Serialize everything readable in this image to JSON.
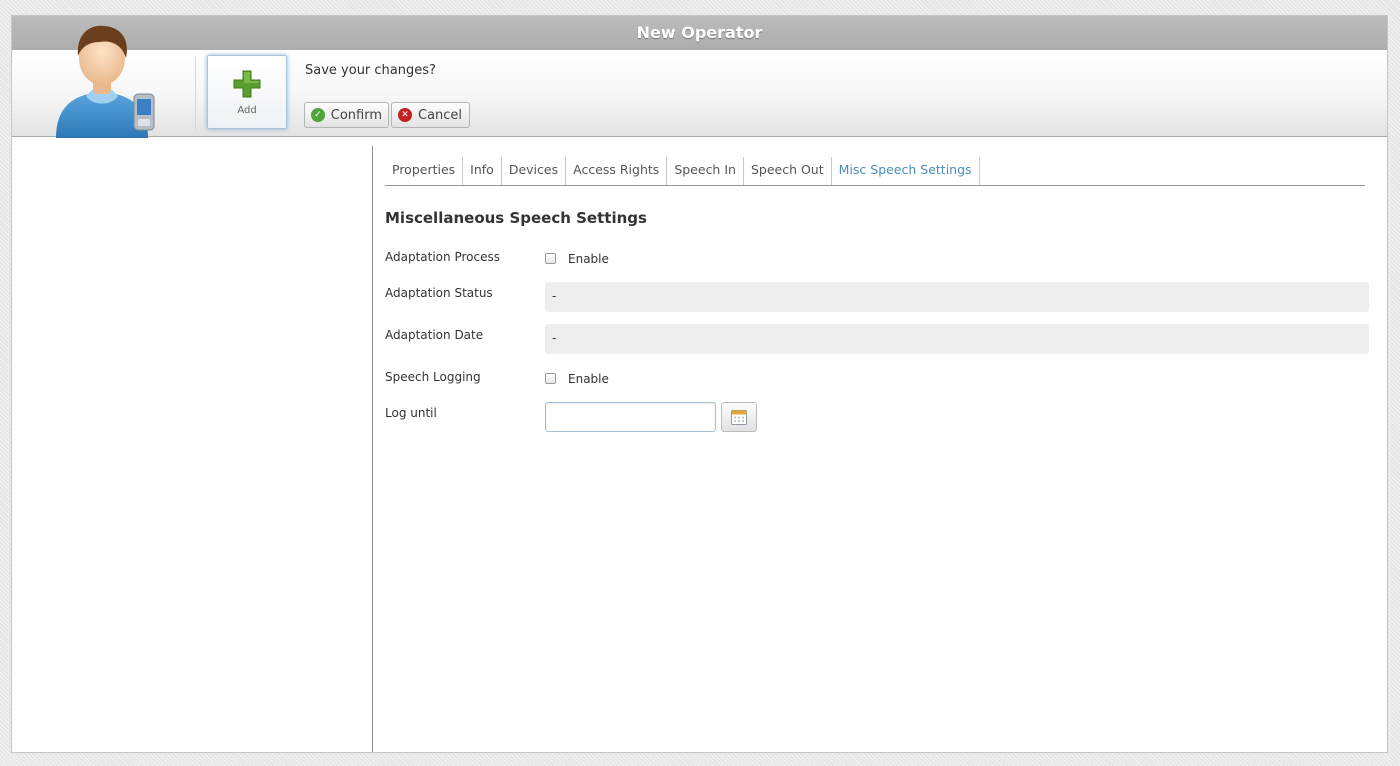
{
  "window": {
    "title": "New Operator"
  },
  "toolbar": {
    "add_label": "Add",
    "prompt": "Save your changes?",
    "confirm_label": "Confirm",
    "cancel_label": "Cancel"
  },
  "tabs": [
    {
      "label": "Properties",
      "active": false
    },
    {
      "label": "Info",
      "active": false
    },
    {
      "label": "Devices",
      "active": false
    },
    {
      "label": "Access Rights",
      "active": false
    },
    {
      "label": "Speech In",
      "active": false
    },
    {
      "label": "Speech Out",
      "active": false
    },
    {
      "label": "Misc Speech Settings",
      "active": true
    }
  ],
  "section": {
    "title": "Miscellaneous Speech Settings",
    "adaptation_process": {
      "label": "Adaptation Process",
      "checkbox_label": "Enable",
      "checked": false
    },
    "adaptation_status": {
      "label": "Adaptation Status",
      "value": "-"
    },
    "adaptation_date": {
      "label": "Adaptation Date",
      "value": "-"
    },
    "speech_logging": {
      "label": "Speech Logging",
      "checkbox_label": "Enable",
      "checked": false
    },
    "log_until": {
      "label": "Log until",
      "value": ""
    }
  },
  "colors": {
    "active_tab": "#4a8db9",
    "confirm_icon": "#4ea63b",
    "cancel_icon": "#c42222",
    "add_icon": "#5a9e2e"
  },
  "icons": {
    "avatar": "operator-avatar-icon",
    "add": "plus-icon",
    "confirm": "check-circle-icon",
    "cancel": "x-circle-icon",
    "calendar": "calendar-icon"
  }
}
